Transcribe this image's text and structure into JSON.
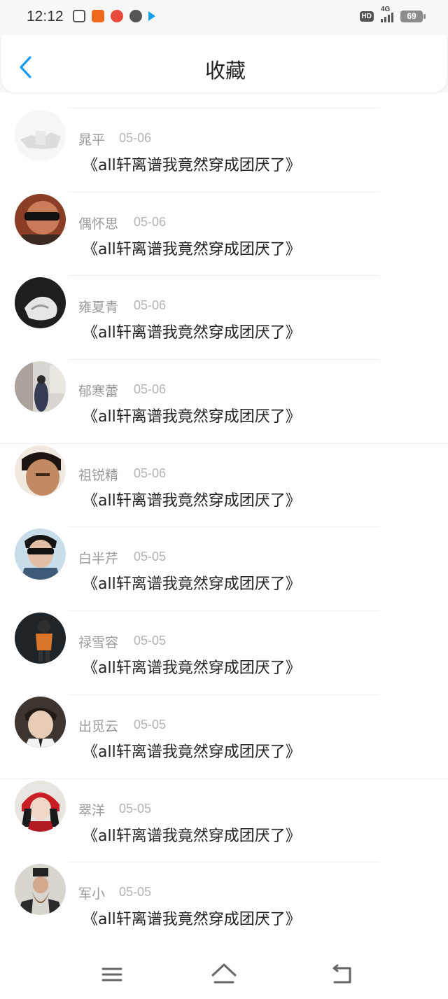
{
  "status_bar": {
    "time": "12:12",
    "hd": "HD",
    "network": "4G",
    "battery": "69"
  },
  "header": {
    "title": "收藏"
  },
  "favorites": [
    {
      "name": "晁平",
      "date": "05-06",
      "title": "《all轩离谱我竟然穿成团厌了》"
    },
    {
      "name": "偶怀思",
      "date": "05-06",
      "title": "《all轩离谱我竟然穿成团厌了》"
    },
    {
      "name": "雍夏青",
      "date": "05-06",
      "title": "《all轩离谱我竟然穿成团厌了》"
    },
    {
      "name": "郁寒蕾",
      "date": "05-06",
      "title": "《all轩离谱我竟然穿成团厌了》"
    },
    {
      "name": "祖锐精",
      "date": "05-06",
      "title": "《all轩离谱我竟然穿成团厌了》"
    },
    {
      "name": "白半芹",
      "date": "05-05",
      "title": "《all轩离谱我竟然穿成团厌了》"
    },
    {
      "name": "禄雪容",
      "date": "05-05",
      "title": "《all轩离谱我竟然穿成团厌了》"
    },
    {
      "name": "出觅云",
      "date": "05-05",
      "title": "《all轩离谱我竟然穿成团厌了》"
    },
    {
      "name": "翠洋",
      "date": "05-05",
      "title": "《all轩离谱我竟然穿成团厌了》"
    },
    {
      "name": "军小",
      "date": "05-05",
      "title": "《all轩离谱我竟然穿成团厌了》"
    }
  ],
  "icons": {
    "back": "chevron-left-icon",
    "menu": "menu-icon",
    "home": "home-icon",
    "return": "return-icon"
  },
  "colors": {
    "accent": "#1a9af0",
    "name_text": "#9a9a9a",
    "date_text": "#b3b3b3"
  }
}
